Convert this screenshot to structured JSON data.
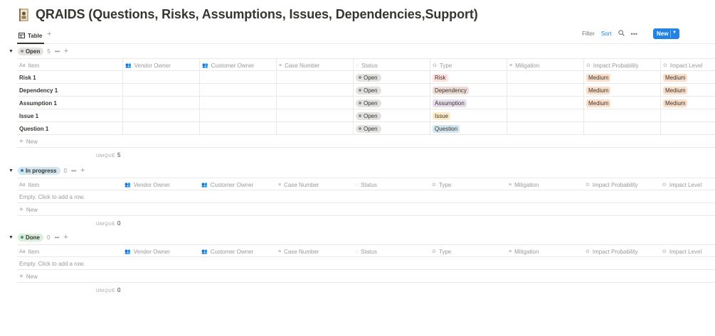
{
  "page": {
    "title": "QRAIDS (Questions, Risks, Assumptions, Issues, Dependencies,Support)",
    "icon": "book-icon"
  },
  "view_bar": {
    "tab_label": "Table",
    "add_view": "+",
    "filter": "Filter",
    "sort": "Sort",
    "new_button": "New"
  },
  "columns": [
    {
      "label": "Item",
      "icon": "Aa"
    },
    {
      "label": "Vendor Owner",
      "icon": "people-icon"
    },
    {
      "label": "Customer Owner",
      "icon": "people-icon"
    },
    {
      "label": "Case Number",
      "icon": "text-lines-icon"
    },
    {
      "label": "Status",
      "icon": "status-icon"
    },
    {
      "label": "Type",
      "icon": "select-icon"
    },
    {
      "label": "Mitigation",
      "icon": "text-lines-icon"
    },
    {
      "label": "Impact Probability",
      "icon": "select-icon"
    },
    {
      "label": "Impact Level",
      "icon": "select-icon"
    }
  ],
  "groups": [
    {
      "label": "Open",
      "count": "5",
      "pill_bg": "#e3e2e0",
      "dot": "#91918e",
      "rows": [
        {
          "item": "Risk 1",
          "status": "Open",
          "type": "Risk",
          "type_bg": "#ffe2dd",
          "probability": "Medium",
          "level": "Medium"
        },
        {
          "item": "Dependency 1",
          "status": "Open",
          "type": "Dependency",
          "type_bg": "#eeddd6",
          "probability": "Medium",
          "level": "Medium"
        },
        {
          "item": "Assumption 1",
          "status": "Open",
          "type": "Assumption",
          "type_bg": "#e8deee",
          "probability": "Medium",
          "level": "Medium"
        },
        {
          "item": "Issue 1",
          "status": "Open",
          "type": "Issue",
          "type_bg": "#fdecc8",
          "probability": "",
          "level": ""
        },
        {
          "item": "Question 1",
          "status": "Open",
          "type": "Question",
          "type_bg": "#d3e5ef",
          "probability": "",
          "level": ""
        }
      ],
      "new_label": "New",
      "calc_label": "UNIQUE",
      "calc_value": "5"
    },
    {
      "label": "In progress",
      "count": "0",
      "pill_bg": "#d3e5ef",
      "dot": "#2e86c1",
      "empty_text": "Empty. Click to add a row.",
      "new_label": "New",
      "calc_label": "UNIQUE",
      "calc_value": "0"
    },
    {
      "label": "Done",
      "count": "0",
      "pill_bg": "#dbeddb",
      "dot": "#4f9768",
      "empty_text": "Empty. Click to add a row.",
      "new_label": "New",
      "calc_label": "UNIQUE",
      "calc_value": "0"
    }
  ],
  "colors": {
    "accent": "#2383e2",
    "medium_tag_bg": "#fadec9",
    "status_tag_bg": "#e3e2e0"
  }
}
